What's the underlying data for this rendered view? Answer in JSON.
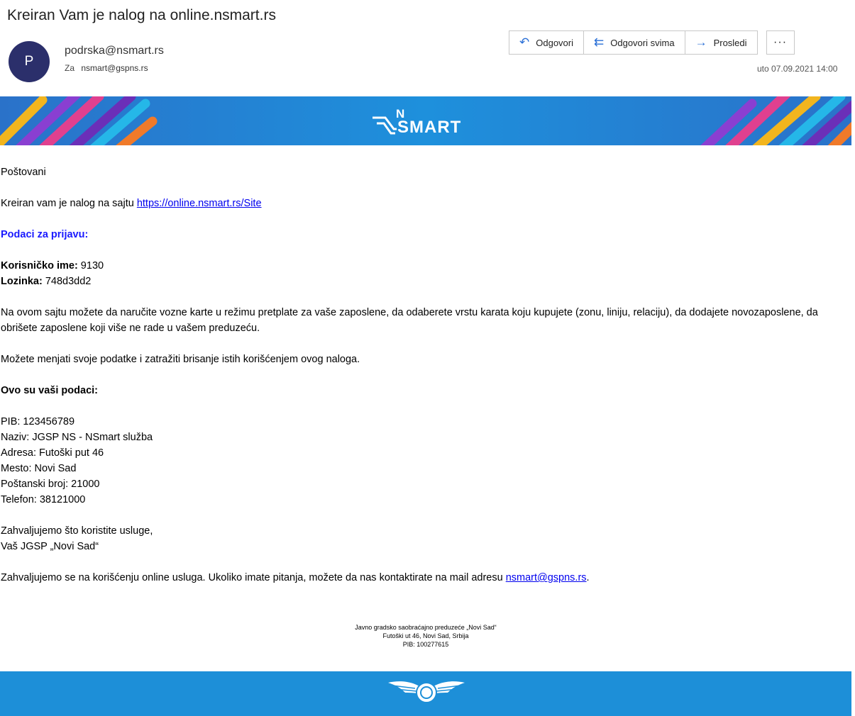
{
  "email": {
    "subject": "Kreiran Vam je nalog na online.nsmart.rs",
    "avatar_letter": "P",
    "sender": "podrska@nsmart.rs",
    "to_prefix": "Za",
    "to": "nsmart@gspns.rs",
    "date": "uto 07.09.2021 14:00"
  },
  "toolbar": {
    "reply_label": "Odgovori",
    "reply_all_label": "Odgovori svima",
    "forward_label": "Prosledi",
    "more_label": "···"
  },
  "banner": {
    "logo_n": "N",
    "logo_text": "SMART"
  },
  "content": {
    "greeting": "Poštovani",
    "intro_text": "Kreiran vam je nalog na sajtu",
    "intro_link": "https://online.nsmart.rs/Site",
    "login_heading": "Podaci za prijavu:",
    "username_label": "Korisničko ime:",
    "username_value": " 9130",
    "password_label": "Lozinka:",
    "password_value": " 748d3dd2",
    "para1": "Na ovom sajtu možete da naručite vozne karte u režimu pretplate za vaše zaposlene, da odaberete vrstu karata koju kupujete (zonu, liniju, relaciju), da dodajete novozaposlene, da obrišete zaposlene koji više ne rade u vašem preduzeću.",
    "para2": "Možete menjati svoje podatke i zatražiti brisanje istih korišćenjem ovog naloga.",
    "details_heading": "Ovo su vaši podaci:",
    "details": [
      "PIB: 123456789",
      "Naziv: JGSP NS - NSmart služba",
      "Adresa: Futoški put 46",
      "Mesto: Novi Sad",
      "Poštanski broj: 21000",
      "Telefon: 38121000"
    ],
    "thanks_line1": "Zahvaljujemo što koristite usluge,",
    "thanks_line2": "Vaš JGSP „Novi Sad“",
    "closing_text": "Zahvaljujemo se na korišćenju online usluga. Ukoliko imate pitanja, možete da nas kontaktirate na mail adresu",
    "closing_link": "nsmart@gspns.rs",
    "closing_end": "."
  },
  "footer": {
    "line1": "Javno gradsko saobraćajno preduzeće „Novi Sad“",
    "line2": "Futoški ut 46, Novi Sad, Srbija",
    "line3": "PIB: 100277615"
  },
  "icons": {
    "reply": "reply-icon",
    "reply_all": "reply-all-icon",
    "forward": "forward-icon",
    "more": "more-icon"
  },
  "colors": {
    "banner_blue": "#1d8fd8",
    "avatar": "#2b2f6b",
    "accent_icon": "#2a6fd6",
    "heading_blue": "#1a1aff"
  }
}
